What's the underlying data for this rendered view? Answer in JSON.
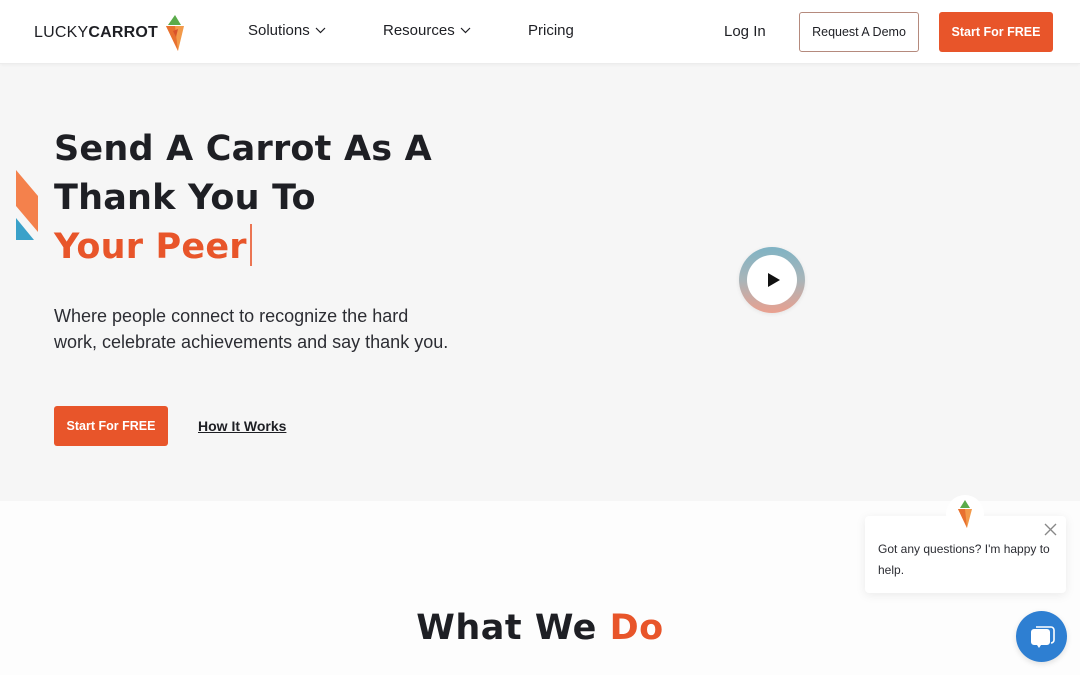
{
  "brand": {
    "name_light": "LUCKY",
    "name_bold": "CARROT",
    "accent_color": "#e8552a",
    "chat_color": "#2e7fd2"
  },
  "nav": {
    "items": [
      {
        "label": "Solutions",
        "has_dropdown": true
      },
      {
        "label": "Resources",
        "has_dropdown": true
      },
      {
        "label": "Pricing",
        "has_dropdown": false
      }
    ],
    "login_label": "Log In",
    "demo_label": "Request A Demo",
    "start_label": "Start For FREE"
  },
  "hero": {
    "title_line1": "Send A Carrot As A",
    "title_line2": "Thank You To",
    "title_accent": "Your Peer",
    "subtitle": "Where people connect to recognize the hard work, celebrate achievements and say thank you.",
    "cta_primary": "Start For FREE",
    "cta_secondary": "How It Works",
    "video_icon": "play-icon"
  },
  "section": {
    "title_main": "What We Do",
    "title_plain": "What We ",
    "title_accent": "Do"
  },
  "chat": {
    "message": "Got any questions? I'm happy to help.",
    "close_icon": "close-icon",
    "launcher_icon": "chat-icon"
  }
}
